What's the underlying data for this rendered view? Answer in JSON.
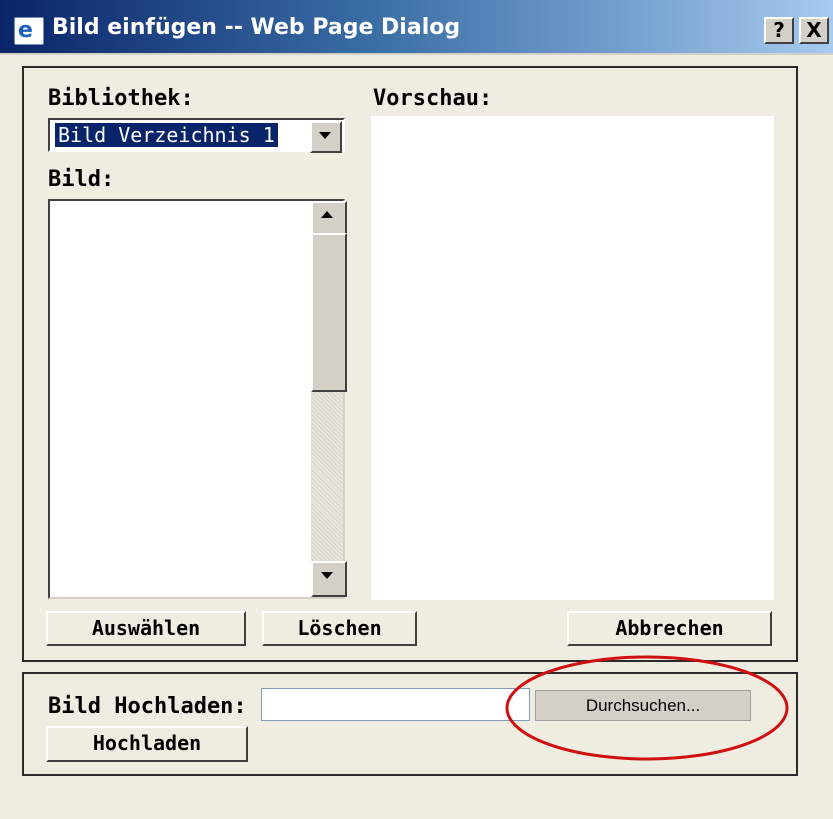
{
  "window": {
    "title": "Bild einfügen -- Web Page Dialog",
    "help_label": "?",
    "close_label": "X",
    "icon": "ie-page-icon",
    "icon_glyph": "e"
  },
  "library": {
    "label": "Bibliothek:",
    "selected_value": "Bild Verzeichnis 1"
  },
  "image_list": {
    "label": "Bild:",
    "items": []
  },
  "preview": {
    "label": "Vorschau:"
  },
  "actions": {
    "select_label": "Auswählen",
    "delete_label": "Löschen",
    "cancel_label": "Abbrechen"
  },
  "upload": {
    "label": "Bild Hochladen:",
    "file_value": "",
    "browse_label": "Durchsuchen...",
    "upload_label": "Hochladen"
  },
  "annotation": {
    "shape": "ellipse",
    "color": "#d01010",
    "target": "browse-button"
  }
}
